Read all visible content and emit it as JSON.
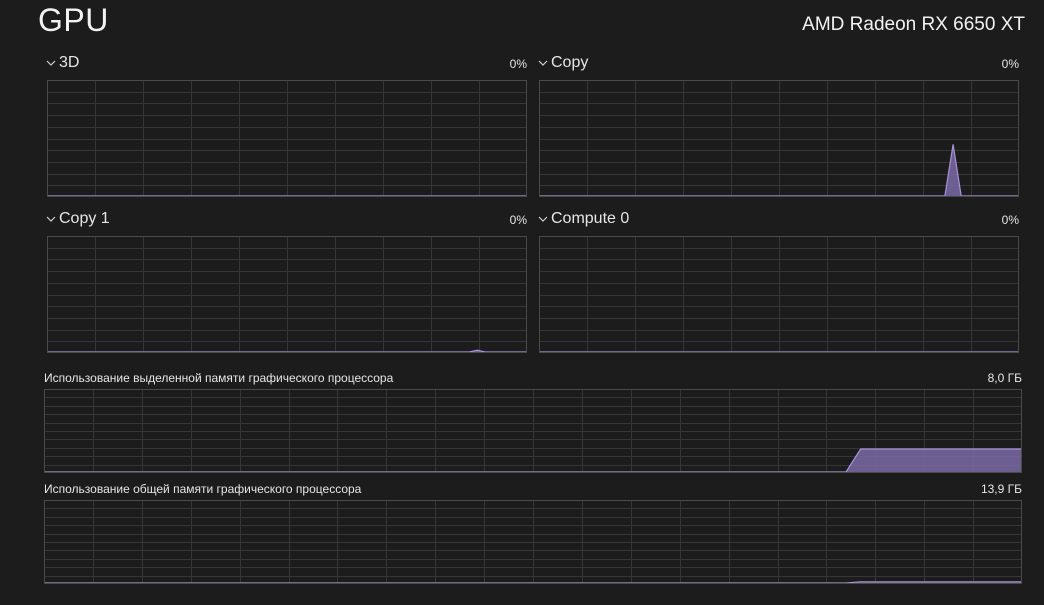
{
  "header": {
    "title": "GPU",
    "device": "AMD Radeon RX 6650 XT"
  },
  "engines": [
    {
      "name": "3D",
      "value": "0%",
      "samples": [
        0,
        0,
        0,
        0,
        0,
        0,
        0,
        0,
        0,
        0,
        0,
        0,
        0,
        0,
        0,
        0,
        0,
        0,
        0,
        0,
        0,
        0,
        0,
        0,
        0,
        0,
        0,
        0,
        0,
        0,
        0,
        0,
        0,
        0,
        0,
        0,
        0,
        0,
        0,
        0,
        0,
        0,
        0,
        0,
        0,
        0,
        0,
        0,
        0,
        0,
        0,
        0,
        0,
        0,
        0,
        0,
        0,
        0,
        0,
        0
      ]
    },
    {
      "name": "Copy",
      "value": "0%",
      "samples": [
        0,
        0,
        0,
        0,
        0,
        0,
        0,
        0,
        0,
        0,
        0,
        0,
        0,
        0,
        0,
        0,
        0,
        0,
        0,
        0,
        0,
        0,
        0,
        0,
        0,
        0,
        0,
        0,
        0,
        0,
        0,
        0,
        0,
        0,
        0,
        0,
        0,
        0,
        0,
        0,
        0,
        0,
        0,
        0,
        0,
        0,
        0,
        0,
        0,
        0,
        0,
        45,
        0,
        0,
        0,
        0,
        0,
        0,
        0,
        0
      ]
    },
    {
      "name": "Copy 1",
      "value": "0%",
      "samples": [
        0,
        0,
        0,
        0,
        0,
        0,
        0,
        0,
        0,
        0,
        0,
        0,
        0,
        0,
        0,
        0,
        0,
        0,
        0,
        0,
        0,
        0,
        0,
        0,
        0,
        0,
        0,
        0,
        0,
        0,
        0,
        0,
        0,
        0,
        0,
        0,
        0,
        0,
        0,
        0,
        0,
        0,
        0,
        0,
        0,
        0,
        0,
        0,
        0,
        0,
        0,
        0,
        0,
        1.5,
        0,
        0,
        0,
        0,
        0,
        0
      ]
    },
    {
      "name": "Compute 0",
      "value": "0%",
      "samples": [
        0,
        0,
        0,
        0,
        0,
        0,
        0,
        0,
        0,
        0,
        0,
        0,
        0,
        0,
        0,
        0,
        0,
        0,
        0,
        0,
        0,
        0,
        0,
        0,
        0,
        0,
        0,
        0,
        0,
        0,
        0,
        0,
        0,
        0,
        0,
        0,
        0,
        0,
        0,
        0,
        0,
        0,
        0,
        0,
        0,
        0,
        0,
        0,
        0,
        0,
        0,
        0,
        0,
        0,
        0,
        0,
        0,
        0,
        0,
        0
      ]
    }
  ],
  "memory": [
    {
      "label": "Использование выделенной памяти графического процессора",
      "value": "8,0 ГБ",
      "samples": [
        0,
        0,
        0,
        0,
        0,
        0,
        0,
        0,
        0,
        0,
        0,
        0,
        0,
        0,
        0,
        0,
        0,
        0,
        0,
        0,
        0,
        0,
        0,
        0,
        0,
        0,
        0,
        0,
        0,
        0,
        0,
        0,
        0,
        0,
        0,
        0,
        0,
        0,
        0,
        0,
        0,
        0,
        0,
        0,
        0,
        0,
        0,
        0,
        0,
        0,
        0,
        0,
        0,
        0,
        0,
        0,
        28,
        28,
        28,
        28,
        28,
        28,
        28,
        28,
        28,
        28,
        28,
        28
      ]
    },
    {
      "label": "Использование общей памяти графического процессора",
      "value": "13,9 ГБ",
      "samples": [
        0,
        0,
        0,
        0,
        0,
        0,
        0,
        0,
        0,
        0,
        0,
        0,
        0,
        0,
        0,
        0,
        0,
        0,
        0,
        0,
        0,
        0,
        0,
        0,
        0,
        0,
        0,
        0,
        0,
        0,
        0,
        0,
        0,
        0,
        0,
        0,
        0,
        0,
        0,
        0,
        0,
        0,
        0,
        0,
        0,
        0,
        0,
        0,
        0,
        0,
        0,
        0,
        0,
        0,
        0,
        0,
        1.5,
        1.5,
        1.5,
        1.5,
        1.5,
        1.5,
        1.5,
        1.5,
        1.5,
        1.5,
        1.5,
        1.5
      ]
    }
  ],
  "colors": {
    "line": "#a892d4",
    "fill": "#7b6aa6",
    "grid": "#363636",
    "border": "#4a4a4a"
  }
}
